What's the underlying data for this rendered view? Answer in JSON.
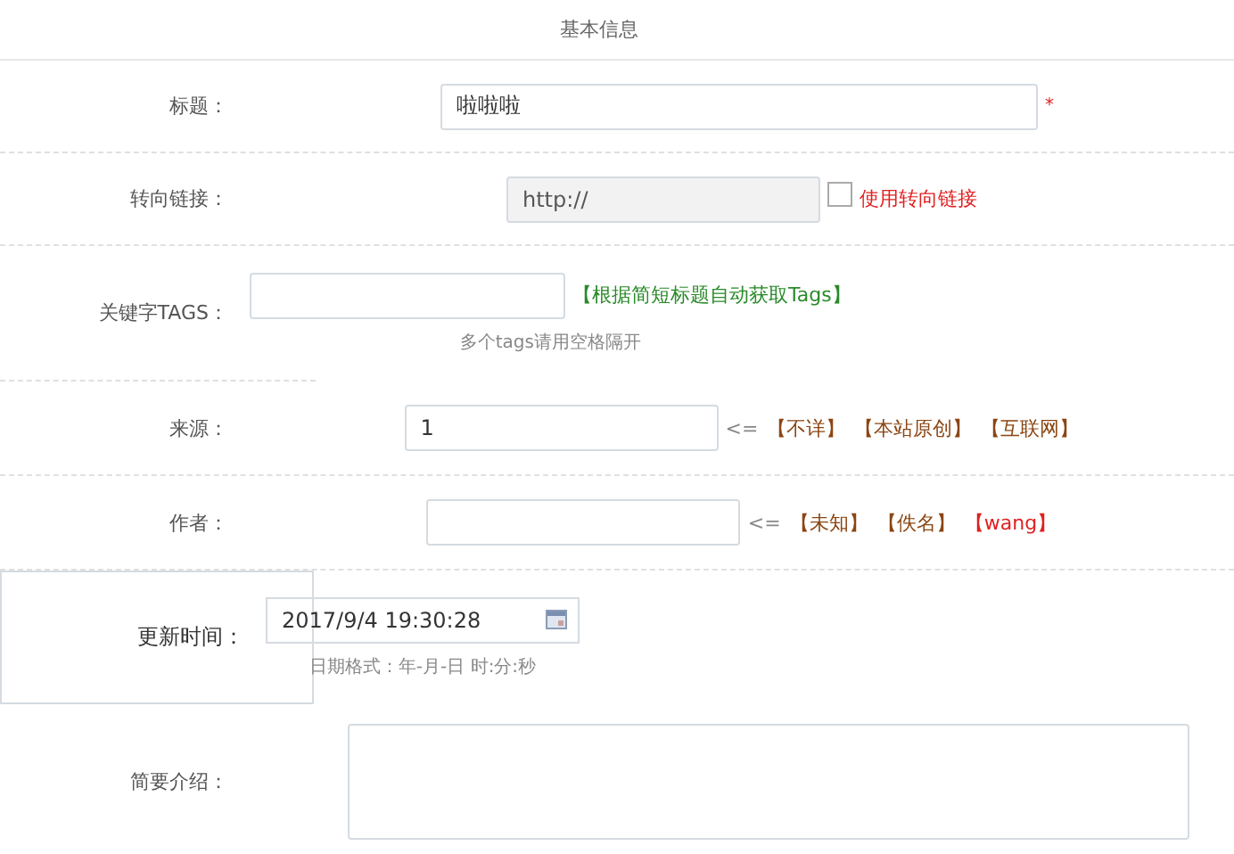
{
  "section_title": "基本信息",
  "fields": [
    {
      "kind": "text",
      "label": "标题：",
      "value": "啦啦啦",
      "required_mark": "*"
    },
    {
      "kind": "redirect",
      "label": "转向链接：",
      "value": "http://",
      "checkbox": {
        "label": "使用转向链接",
        "checked": false
      }
    },
    {
      "kind": "tags",
      "label": "关键字TAGS：",
      "action": "【根据简短标题自动获取Tags】",
      "hint": "多个tags请用空格隔开"
    },
    {
      "kind": "choices",
      "label": "来源：",
      "value": "1",
      "prefix": "<=",
      "options": [
        {
          "label": "【不详】",
          "color": "#8b4513"
        },
        {
          "label": "【本站原创】",
          "color": "#8b4513"
        },
        {
          "label": "【互联网】",
          "color": "#8b4513"
        }
      ]
    },
    {
      "kind": "choices",
      "label": "作者：",
      "prefix": "<=",
      "options": [
        {
          "label": "【未知】",
          "color": "#8b4513"
        },
        {
          "label": "【佚名】",
          "color": "#8b4513"
        },
        {
          "label": "【wang】",
          "color": "#e02020"
        }
      ]
    },
    {
      "kind": "date",
      "label": "更新时间：",
      "value": "2017/9/4 19:30:28",
      "hint": "日期格式：年-月-日 时:分:秒"
    },
    {
      "kind": "textarea",
      "label": "简要介绍："
    }
  ]
}
